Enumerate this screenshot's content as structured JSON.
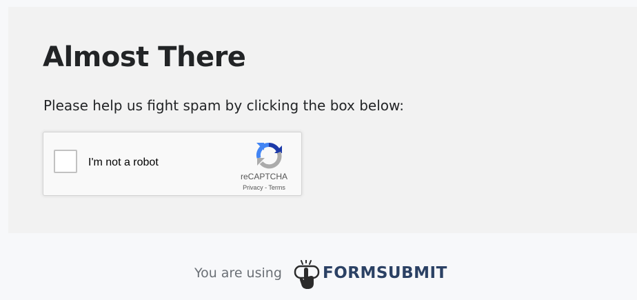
{
  "heading": "Almost There",
  "instructions": "Please help us fight spam by clicking the box below:",
  "captcha": {
    "checkbox_label": "I'm not a robot",
    "checked": false,
    "brand": "reCAPTCHA",
    "privacy_link": "Privacy",
    "separator": " - ",
    "terms_link": "Terms",
    "logo_icon": "recaptcha-logo-icon"
  },
  "footer": {
    "prefix": "You are using",
    "brand": "FORMSUBMIT",
    "brand_icon": "pointing-hand-icon",
    "brand_color": "#2b4164"
  }
}
